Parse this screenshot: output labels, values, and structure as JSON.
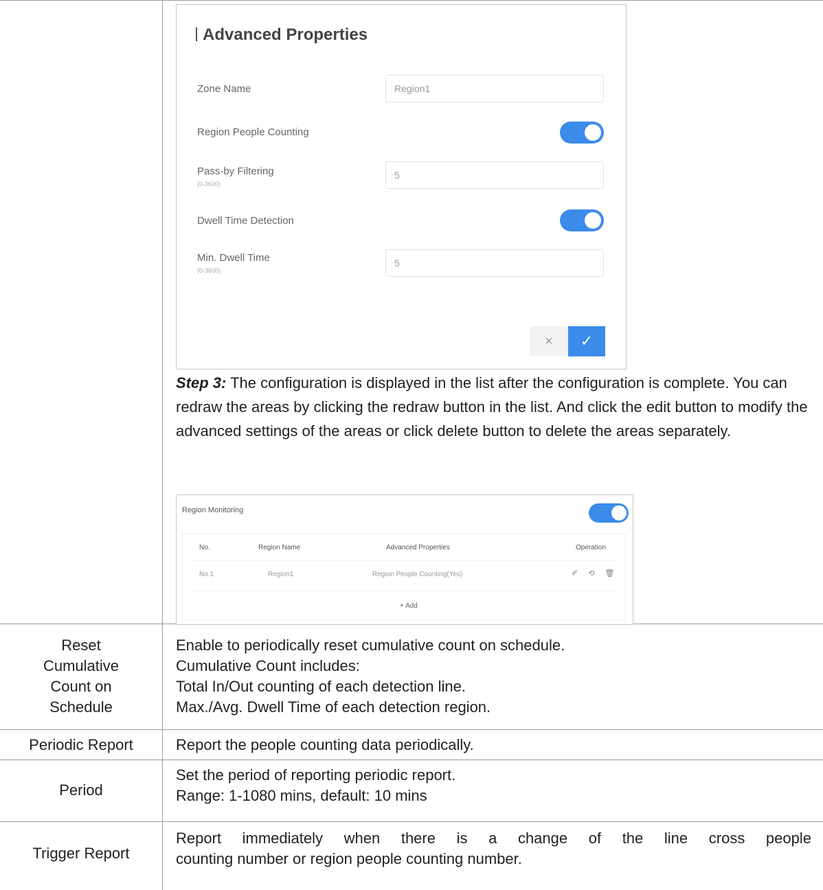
{
  "advanced_panel": {
    "title": "Advanced Properties",
    "zone_name_label": "Zone Name",
    "zone_name_value": "Region1",
    "region_counting_label": "Region People Counting",
    "region_counting_on": true,
    "passby_label": "Pass-by Filtering",
    "passby_range": "(0-3600)",
    "passby_value": "5",
    "dwell_label": "Dwell Time Detection",
    "dwell_on": true,
    "min_dwell_label": "Min. Dwell Time",
    "min_dwell_range": "(0-3600)",
    "min_dwell_value": "5",
    "cancel_icon": "×",
    "confirm_icon": "✓"
  },
  "step3": {
    "prefix": "Step 3:",
    "text": " The configuration is displayed in the list after the configuration is complete. You can redraw the areas by clicking the redraw button in the list. And click the edit button to modify the advanced settings of the areas or click delete button to delete the areas separately."
  },
  "region_monitoring": {
    "title": "Region Monitoring",
    "enabled": true,
    "columns": [
      "No.",
      "Region Name",
      "Advanced Properties",
      "Operation"
    ],
    "rows": [
      {
        "no": "No.1",
        "name": "Region1",
        "props": "Region People Counting(Yes)"
      }
    ],
    "ops_icons": "✐ ⟲ 🗑",
    "add_label": "+ Add"
  },
  "rows": {
    "reset": {
      "label_lines": [
        "Reset",
        "Cumulative",
        "Count on",
        "Schedule"
      ],
      "lines": [
        "Enable to periodically reset cumulative count on schedule.",
        "Cumulative Count includes:",
        "Total In/Out counting of each detection line.",
        "Max./Avg. Dwell Time of each detection region."
      ]
    },
    "periodic": {
      "label": "Periodic Report",
      "text": "Report the people counting data periodically."
    },
    "period": {
      "label": "Period",
      "lines": [
        "Set the period of reporting periodic report.",
        "Range: 1-1080 mins, default: 10 mins"
      ]
    },
    "trigger": {
      "label": "Trigger Report",
      "lines": [
        "Report immediately when there is a change of the line cross people",
        "counting number or region people counting number."
      ]
    }
  }
}
